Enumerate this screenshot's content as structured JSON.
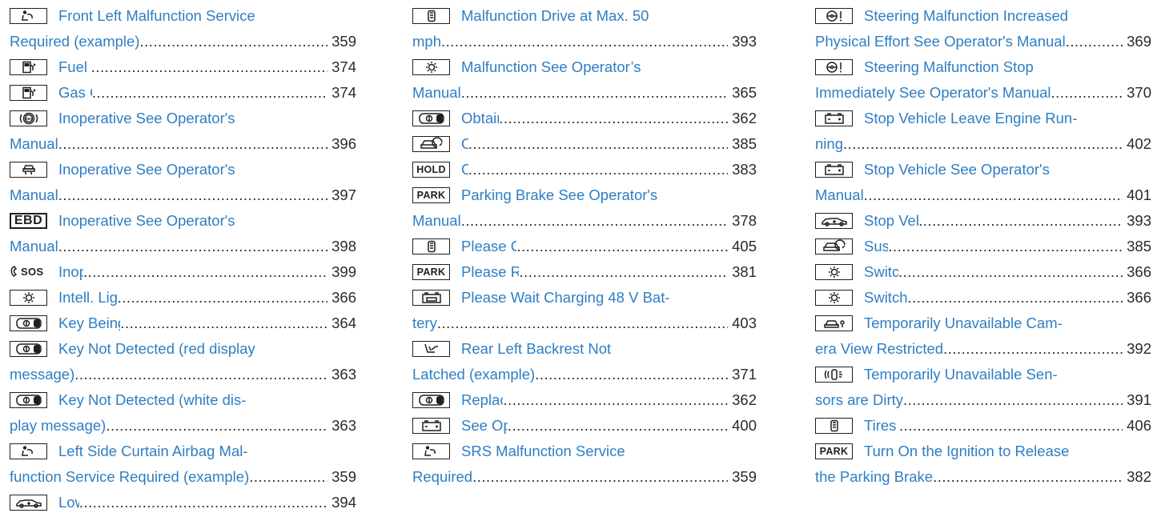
{
  "columns": [
    [
      {
        "icon": "seat-occupant-airbag-icon",
        "lines": [
          "Front Left Malfunction Service",
          "Required (example)"
        ],
        "page": "359"
      },
      {
        "icon": "fuel-pump-icon",
        "lines": [
          "Fuel Level Low"
        ],
        "page": "374"
      },
      {
        "icon": "fuel-pump-icon",
        "lines": [
          "Gas Cap Loose"
        ],
        "page": "374"
      },
      {
        "icon": "abs-icon",
        "lines": [
          "Inoperative See Operator's",
          "Manual"
        ],
        "page": "396"
      },
      {
        "icon": "skidding-car-icon",
        "lines": [
          "Inoperative See Operator's",
          "Manual"
        ],
        "page": "397"
      },
      {
        "icon": "ebd-icon",
        "icon_text": "EBD",
        "lines": [
          "Inoperative See Operator's",
          "Manual"
        ],
        "page": "398"
      },
      {
        "icon": "sos-call-icon",
        "icon_text": "SOS",
        "lines": [
          "Inoperative"
        ],
        "page": "399"
      },
      {
        "icon": "light-bulb-icon",
        "lines": [
          "Intell. Light System Inoperative"
        ],
        "page": "366"
      },
      {
        "icon": "key-icon",
        "lines": [
          "Key Being Initialized Please Wait"
        ],
        "page": "364"
      },
      {
        "icon": "key-icon",
        "lines": [
          "Key Not Detected  (red display",
          "message)"
        ],
        "page": "363"
      },
      {
        "icon": "key-icon",
        "lines": [
          "Key Not Detected  (white dis-",
          "play message)"
        ],
        "page": "363"
      },
      {
        "icon": "seat-occupant-airbag-icon",
        "lines": [
          "Left Side Curtain Airbag Mal-",
          "function Service Required (example)"
        ],
        "page": "359"
      },
      {
        "icon": "car-level-icon",
        "lines": [
          "Lowering"
        ],
        "page": "394"
      }
    ],
    [
      {
        "icon": "tire-pressure-icon",
        "lines": [
          "Malfunction Drive at Max. 50",
          "mph"
        ],
        "page": "393"
      },
      {
        "icon": "light-bulb-icon",
        "lines": [
          "Malfunction See Operator’s",
          "Manual"
        ],
        "page": "365"
      },
      {
        "icon": "key-icon",
        "lines": [
          "Obtain a New Key"
        ],
        "page": "362"
      },
      {
        "icon": "car-speedometer-icon",
        "lines": [
          "Off"
        ],
        "page": "385"
      },
      {
        "icon": "hold-icon",
        "icon_text": "HOLD",
        "lines": [
          "Off"
        ],
        "page": "383"
      },
      {
        "icon": "park-icon",
        "icon_text": "PARK",
        "lines": [
          "Parking Brake See Operator's",
          "Manual"
        ],
        "page": "378"
      },
      {
        "icon": "tire-pressure-icon",
        "lines": [
          "Please Correct Tire Pressure"
        ],
        "page": "405"
      },
      {
        "icon": "park-icon",
        "icon_text": "PARK",
        "lines": [
          "Please Release Parking Brake"
        ],
        "page": "381"
      },
      {
        "icon": "battery-48v-icon",
        "lines": [
          "Please Wait Charging 48 V Bat-",
          "tery"
        ],
        "page": "403"
      },
      {
        "icon": "seat-backrest-icon",
        "lines": [
          "Rear Left Backrest Not",
          "Latched (example)"
        ],
        "page": "371"
      },
      {
        "icon": "key-icon",
        "lines": [
          "Replace Key Battery"
        ],
        "page": "362"
      },
      {
        "icon": "battery-icon",
        "lines": [
          "See Operator's Manual"
        ],
        "page": "400"
      },
      {
        "icon": "seat-occupant-airbag-icon",
        "lines": [
          "SRS Malfunction Service",
          "Required"
        ],
        "page": "359"
      }
    ],
    [
      {
        "icon": "steering-wheel-warning-icon",
        "lines": [
          "Steering Malfunction Increased",
          "Physical Effort See Operator's Manual"
        ],
        "page": "369"
      },
      {
        "icon": "steering-wheel-warning-icon",
        "lines": [
          "Steering Malfunction Stop",
          "Immediately See Operator's Manual"
        ],
        "page": "370"
      },
      {
        "icon": "battery-icon",
        "lines": [
          "Stop Vehicle Leave Engine Run-",
          "ning"
        ],
        "page": "402"
      },
      {
        "icon": "battery-icon",
        "lines": [
          "Stop Vehicle See Operator's",
          "Manual"
        ],
        "page": "401"
      },
      {
        "icon": "car-level-icon",
        "lines": [
          "Stop Vehicle Vehicle Too Low"
        ],
        "page": "393"
      },
      {
        "icon": "car-speedometer-icon",
        "lines": [
          "Suspended"
        ],
        "page": "385"
      },
      {
        "icon": "light-bulb-icon",
        "lines": [
          "Switch Off Lights"
        ],
        "page": "366"
      },
      {
        "icon": "light-bulb-icon",
        "lines": [
          "Switch On Headlamps"
        ],
        "page": "366"
      },
      {
        "icon": "camera-car-icon",
        "lines": [
          "Temporarily Unavailable Cam-",
          "era View Restricted"
        ],
        "page": "392"
      },
      {
        "icon": "parking-sensor-icon",
        "lines": [
          "Temporarily Unavailable Sen-",
          "sors are Dirty"
        ],
        "page": "391"
      },
      {
        "icon": "tire-pressure-icon",
        "lines": [
          "Tires Overheated"
        ],
        "page": "406"
      },
      {
        "icon": "park-icon",
        "icon_text": "PARK",
        "lines": [
          "Turn On the Ignition to Release",
          "the Parking Brake"
        ],
        "page": "382"
      }
    ]
  ],
  "colors": {
    "link": "#2e7ec4",
    "text": "#2a2a2a",
    "icon_border": "#1f1f1f"
  }
}
